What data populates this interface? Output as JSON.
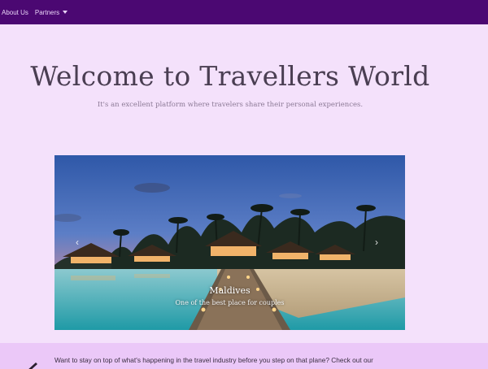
{
  "nav": {
    "items": [
      {
        "label": "About Us"
      },
      {
        "label": "Partners"
      }
    ]
  },
  "hero": {
    "title": "Welcome to Travellers World",
    "subtitle": "It's an excellent platform where travelers share their personal experiences."
  },
  "carousel": {
    "slide_title": "Maldives",
    "slide_caption": "One of the best place for couples",
    "prev_icon": "‹",
    "next_icon": "›"
  },
  "news": {
    "text": "Want to stay on top of what's happening in the travel industry before you step on that plane? Check out our"
  },
  "colors": {
    "navbar": "#4b0872",
    "background": "#f4e1fb",
    "news_band": "#ebc8f8"
  }
}
